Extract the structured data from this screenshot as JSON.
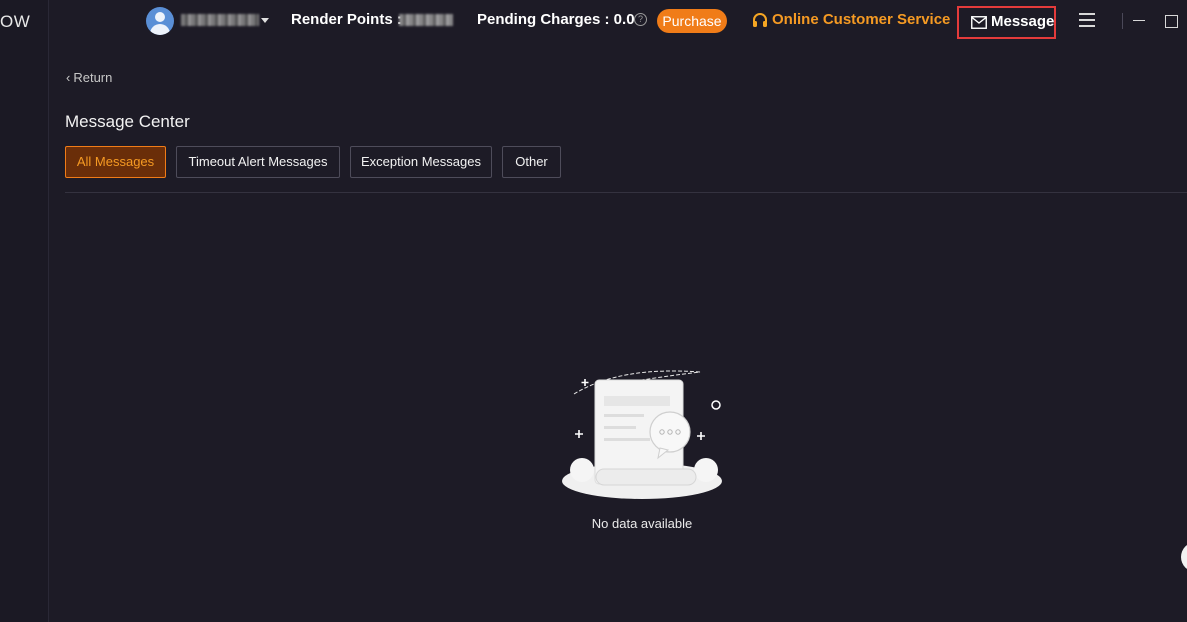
{
  "app": {
    "brand_fragment": "OW"
  },
  "header": {
    "render_points_label": "Render Points :",
    "pending_charges_label": "Pending Charges : 0.0",
    "help_symbol": "?",
    "purchase_label": "Purchase",
    "support_label": "Online Customer Service",
    "message_label": "Message"
  },
  "page": {
    "return_label": "Return",
    "title": "Message Center",
    "tabs": [
      {
        "label": "All Messages",
        "active": true
      },
      {
        "label": "Timeout Alert Messages",
        "active": false
      },
      {
        "label": "Exception Messages",
        "active": false
      },
      {
        "label": "Other",
        "active": false
      }
    ],
    "empty_text": "No data available"
  },
  "colors": {
    "background": "#1d1b26",
    "accent_orange": "#f07c18",
    "support_orange": "#f59a23",
    "highlight_red": "#e43b3b"
  },
  "icons": [
    "avatar-icon",
    "caret-down-icon",
    "help-icon",
    "headset-icon",
    "mail-icon",
    "menu-icon",
    "minimize-icon",
    "maximize-icon",
    "chevron-left-icon",
    "empty-messages-icon"
  ]
}
